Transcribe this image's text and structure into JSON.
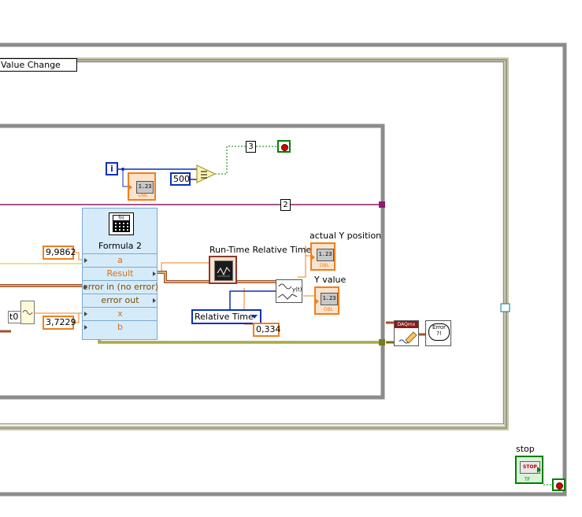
{
  "event_selector": {
    "label": "Value Change"
  },
  "numeric_constants": {
    "loop_iter_compare": "3",
    "shift_index": "2",
    "limit": "500",
    "a_value": "9,9862",
    "b_value": "3,7229",
    "time_value": "0,334"
  },
  "formula_node": {
    "title": "Formula 2",
    "rows": [
      "a",
      "Result",
      "error in (no error)",
      "error out",
      "x",
      "b"
    ]
  },
  "labels": {
    "runtime": "Run-Time Relative Time",
    "actual_y": "actual Y position",
    "y_value": "Y value",
    "stop": "stop",
    "t0": "t0",
    "iteration": "i"
  },
  "relative_time_ring": {
    "value": "Relative Time"
  },
  "indicator": {
    "inner_text": "1.23",
    "type_text": "DBL"
  },
  "stop_button": {
    "text": "STOP",
    "type_text": "TF"
  },
  "daqmx": {
    "label": "DAQmx"
  },
  "error_handler": {
    "label": "Error ?!"
  },
  "colors": {
    "frame": "#8c8c8c",
    "event_frame": "#c8c8a8",
    "numeric_orange": "#f07f1d",
    "integer_blue": "#0b2fbf",
    "boolean_green": "#007f00",
    "error_wire": "#a0522d",
    "formula_bg": "#d6ebfa"
  }
}
